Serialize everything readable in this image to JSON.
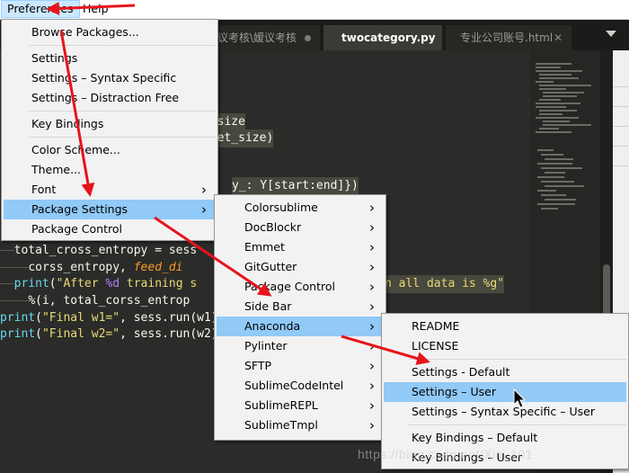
{
  "menubar": {
    "preferences": "Preferences",
    "help": "Help"
  },
  "tabs": [
    {
      "label": "议考核\\嫒议考核",
      "state": "modified"
    },
    {
      "label": "twocategory.py",
      "state": "active"
    },
    {
      "label": "专业公司账号.html",
      "state": "closable"
    }
  ],
  "editor": {
    "lines": [
      {
        "segments": [
          {
            "t": "t_size",
            "c": "sel"
          }
        ]
      },
      {
        "segments": [
          {
            "t": "aset_size)",
            "c": "sel"
          }
        ]
      },
      {
        "segments": [
          {
            "t": "y_: Y[start:end]})",
            "c": "sel"
          }
        ]
      },
      {
        "segments": [
          {
            "t": "total_cross_entropy = sess",
            "c": ""
          }
        ]
      },
      {
        "segments": [
          {
            "t": "corss_entropy, ",
            "c": ""
          },
          {
            "t": "feed_di",
            "c": "ital"
          }
        ]
      },
      {
        "segments": [
          {
            "t": "print",
            "c": "kw-fn"
          },
          {
            "t": "(",
            "c": ""
          },
          {
            "t": "\"After ",
            "c": "str"
          },
          {
            "t": "%d",
            "c": "pct"
          },
          {
            "t": " training s",
            "c": "str"
          }
        ]
      },
      {
        "segments": [
          {
            "t": "%(i, total_corss_entrop",
            "c": ""
          }
        ]
      },
      {
        "segments": [
          {
            "t": "print",
            "c": "kw-fn"
          },
          {
            "t": "(",
            "c": ""
          },
          {
            "t": "\"Final w1=\"",
            "c": "str"
          },
          {
            "t": ", sess.run(w1)",
            "c": ""
          }
        ]
      },
      {
        "segments": [
          {
            "t": "print",
            "c": "kw-fn"
          },
          {
            "t": "(",
            "c": ""
          },
          {
            "t": "\"Final w2=\"",
            "c": "str"
          },
          {
            "t": ", sess.run(w2)",
            "c": ""
          }
        ]
      },
      {
        "segments": [
          {
            "t": "n all data is %g\"",
            "c": "str"
          }
        ]
      }
    ]
  },
  "preferences_menu": {
    "items": [
      {
        "label": "Browse Packages...",
        "arrow": false
      },
      {
        "sep": true
      },
      {
        "label": "Settings",
        "arrow": false
      },
      {
        "label": "Settings – Syntax Specific",
        "arrow": false
      },
      {
        "label": "Settings – Distraction Free",
        "arrow": false
      },
      {
        "sep": true
      },
      {
        "label": "Key Bindings",
        "arrow": false
      },
      {
        "sep": true
      },
      {
        "label": "Color Scheme...",
        "arrow": false
      },
      {
        "label": "Theme...",
        "arrow": false
      },
      {
        "label": "Font",
        "arrow": true
      },
      {
        "label": "Package Settings",
        "arrow": true,
        "highlighted": true
      },
      {
        "label": "Package Control",
        "arrow": false
      }
    ]
  },
  "package_settings_menu": {
    "items": [
      {
        "label": "Colorsublime",
        "arrow": true
      },
      {
        "label": "DocBlockr",
        "arrow": true
      },
      {
        "label": "Emmet",
        "arrow": true
      },
      {
        "label": "GitGutter",
        "arrow": true
      },
      {
        "label": "Package Control",
        "arrow": true
      },
      {
        "label": "Side Bar",
        "arrow": true
      },
      {
        "label": "Anaconda",
        "arrow": true,
        "highlighted": true
      },
      {
        "label": "Pylinter",
        "arrow": true
      },
      {
        "label": "SFTP",
        "arrow": true
      },
      {
        "label": "SublimeCodeIntel",
        "arrow": true
      },
      {
        "label": "SublimeREPL",
        "arrow": true
      },
      {
        "label": "SublimeTmpl",
        "arrow": true
      }
    ]
  },
  "anaconda_menu": {
    "items": [
      {
        "label": "README"
      },
      {
        "label": "LICENSE"
      },
      {
        "sep": true
      },
      {
        "label": "Settings - Default"
      },
      {
        "label": "Settings – User",
        "highlighted": true
      },
      {
        "label": "Settings – Syntax Specific – User"
      },
      {
        "sep": true
      },
      {
        "label": "Key Bindings – Default"
      },
      {
        "label": "Key Bindings – User"
      }
    ]
  },
  "watermark": "https://blog.csdn.net/Xin_101",
  "colors": {
    "menu_highlight": "#91c9f7",
    "annotation_arrow": "#e8141b",
    "editor_bg": "#2b2b29"
  },
  "icons": [
    "mouse-cursor-icon",
    "submenu-arrow-icon",
    "tab-close-icon",
    "tab-modified-dot-icon",
    "tab-overflow-icon"
  ]
}
